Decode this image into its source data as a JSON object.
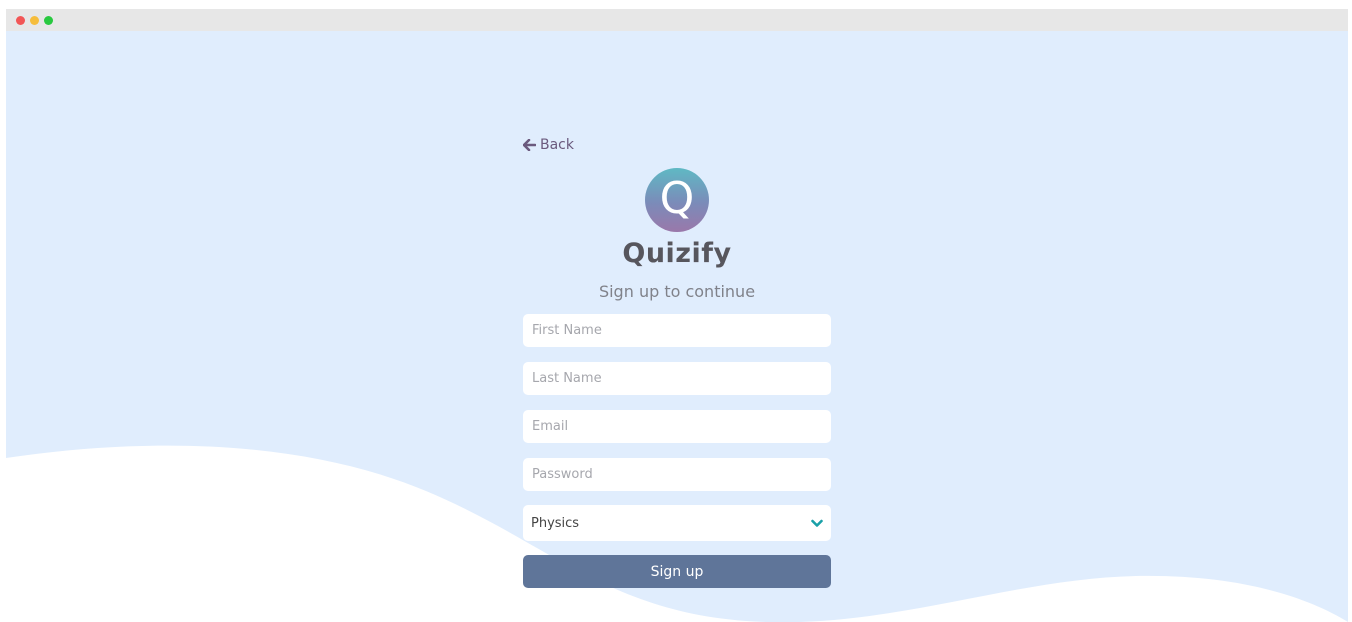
{
  "window": {
    "controls": [
      "close",
      "minimize",
      "maximize"
    ]
  },
  "nav": {
    "back_label": "Back"
  },
  "brand": {
    "logo_letter": "Q",
    "name": "Quizify"
  },
  "form": {
    "heading": "Sign up to continue",
    "first_name_placeholder": "First Name",
    "last_name_placeholder": "Last Name",
    "email_placeholder": "Email",
    "password_placeholder": "Password",
    "subject_selected": "Physics",
    "submit_label": "Sign up"
  },
  "colors": {
    "background": "#e0edfd",
    "button": "#5f7599",
    "back_link": "#6b5a7e",
    "brand_text": "#57565d",
    "chevron": "#1aa0a8"
  }
}
